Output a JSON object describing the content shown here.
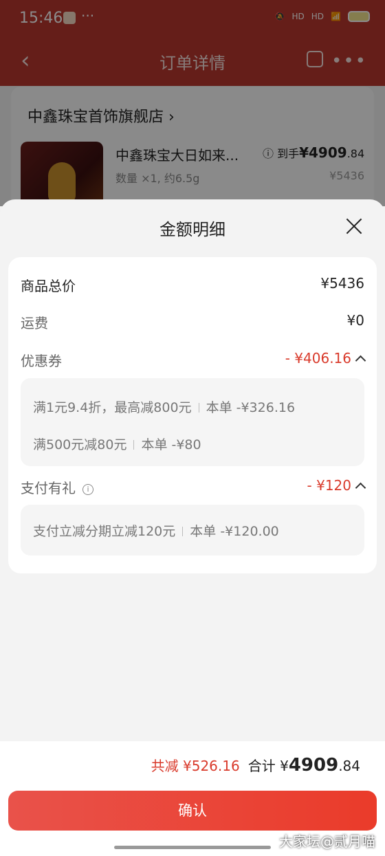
{
  "status_bar": {
    "time": "15:46",
    "dots": "···",
    "net1": "HD",
    "net2": "HD",
    "battery": "67"
  },
  "nav": {
    "back": "‹",
    "title": "订单详情",
    "more": "•••"
  },
  "shop": {
    "name": "中鑫珠宝首饰旗舰店 ›"
  },
  "product": {
    "title": "中鑫珠宝大日如来...",
    "spec": "数量 ×1, 约6.5g",
    "price_prefix": "ⓘ 到手",
    "price_main": "¥4909",
    "price_dec": ".84",
    "original_price": "¥5436"
  },
  "sheet": {
    "title": "金额明细",
    "rows": {
      "goods_total": {
        "label": "商品总价",
        "value": "¥5436"
      },
      "shipping": {
        "label": "运费",
        "value": "¥0"
      },
      "coupon": {
        "label": "优惠券",
        "value": "- ¥406.16"
      },
      "pay_gift": {
        "label": "支付有礼",
        "value": "- ¥120"
      }
    },
    "coupon_details": [
      {
        "text": "满1元9.4折，最高减800元",
        "amount": "本单 -¥326.16"
      },
      {
        "text": "满500元减80元",
        "amount": "本单 -¥80"
      }
    ],
    "pay_details": [
      {
        "text": "支付立减分期立减120元",
        "amount": "本单 -¥120.00"
      }
    ],
    "info_icon": "i"
  },
  "footer": {
    "saved": "共减 ¥526.16",
    "total_label": "合计 ¥",
    "total_main": "4909",
    "total_dec": ".84",
    "confirm": "确认"
  },
  "watermark": "大家坛@贰月喵"
}
